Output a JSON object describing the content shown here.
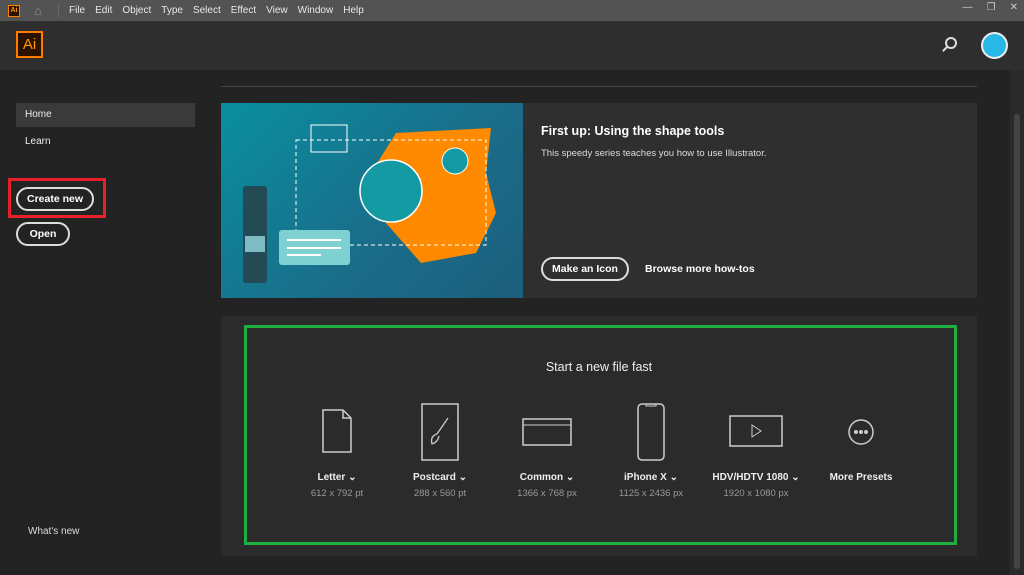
{
  "menubar": {
    "logo": "Ai",
    "items": [
      "File",
      "Edit",
      "Object",
      "Type",
      "Select",
      "Effect",
      "View",
      "Window",
      "Help"
    ]
  },
  "header": {
    "logo": "Ai"
  },
  "sidebar": {
    "home": "Home",
    "learn": "Learn",
    "create_new": "Create new",
    "open": "Open",
    "whats_new": "What's new"
  },
  "tutorial": {
    "title": "First up: Using the shape tools",
    "desc": "This speedy series teaches you how to use Illustrator.",
    "button": "Make an Icon",
    "link": "Browse more how-tos"
  },
  "presets": {
    "title": "Start a new file fast",
    "items": [
      {
        "name": "Letter",
        "size": "612 x 792 pt"
      },
      {
        "name": "Postcard",
        "size": "288 x 560 pt"
      },
      {
        "name": "Common",
        "size": "1366 x 768 px"
      },
      {
        "name": "iPhone X",
        "size": "1125 x 2436 px"
      },
      {
        "name": "HDV/HDTV 1080",
        "size": "1920 x 1080 px"
      },
      {
        "name": "More Presets"
      }
    ]
  },
  "colors": {
    "accent": "#ff7c00",
    "highlight_red": "#e8202a",
    "highlight_green": "#1fae40"
  }
}
